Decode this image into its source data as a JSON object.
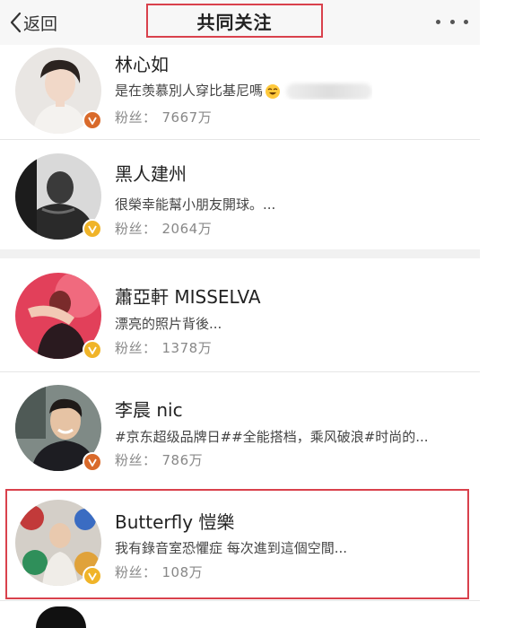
{
  "header": {
    "back_label": "返回",
    "title": "共同关注"
  },
  "fans_label": "粉丝：",
  "users": [
    {
      "name": "林心如",
      "desc": "是在羡慕別人穿比基尼嗎",
      "fans": "7667万",
      "badge_color": "#d96a2b",
      "has_emoji": true
    },
    {
      "name": "黑人建州",
      "desc": "很榮幸能幫小朋友開球。...",
      "fans": "2064万",
      "badge_color": "#f0b429"
    },
    {
      "name": "蕭亞軒 MISSELVA",
      "desc": "漂亮的照片背後...",
      "fans": "1378万",
      "badge_color": "#f0b429"
    },
    {
      "name": "李晨 nic",
      "desc": "#京东超级品牌日##全能搭档，乘风破浪#时尚的...",
      "fans": "786万",
      "badge_color": "#d96a2b"
    },
    {
      "name": "Butterfly 愷樂",
      "desc": "我有錄音室恐懼症 每次進到這個空間...",
      "fans": "108万",
      "badge_color": "#f0b429"
    }
  ],
  "colors": {
    "highlight": "#d9414c",
    "header_bg": "#f7f7f7"
  }
}
